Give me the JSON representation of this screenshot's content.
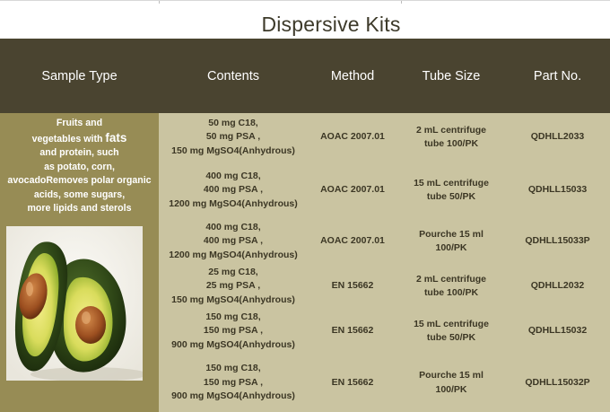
{
  "title": "Dispersive Kits",
  "columns": [
    "Sample Type",
    "Contents",
    "Method",
    "Tube Size",
    "Part No."
  ],
  "sample_type": {
    "line1": "Fruits and",
    "line2_pre": "vegetables with ",
    "line2_big": "fats",
    "line3": "and protein, such",
    "line4": "as potato, corn,",
    "line5": "avocadoRemoves polar organic",
    "line6": "acids, some sugars,",
    "line7": "more lipids and sterols"
  },
  "rows": [
    {
      "contents": [
        "50 mg C18,",
        "50 mg PSA ,",
        "150 mg MgSO4(Anhydrous)"
      ],
      "method": "AOAC 2007.01",
      "tube": [
        "2 mL centrifuge",
        "tube 100/PK"
      ],
      "part": "QDHLL2033"
    },
    {
      "contents": [
        "400 mg C18,",
        "400 mg PSA ,",
        "1200 mg MgSO4(Anhydrous)"
      ],
      "method": "AOAC 2007.01",
      "tube": [
        "15 mL centrifuge",
        "tube 50/PK"
      ],
      "part": "QDHLL15033"
    },
    {
      "contents": [
        "400 mg C18,",
        "400 mg PSA ,",
        "1200 mg MgSO4(Anhydrous)"
      ],
      "method": "AOAC 2007.01",
      "tube": [
        "Pourche 15 ml",
        "100/PK"
      ],
      "part": "QDHLL15033P"
    },
    {
      "contents": [
        "25 mg C18,",
        "25 mg PSA ,",
        "150 mg MgSO4(Anhydrous)"
      ],
      "method": "EN 15662",
      "tube": [
        "2 mL centrifuge",
        "tube 100/PK"
      ],
      "part": "QDHLL2032"
    },
    {
      "contents": [
        "150 mg C18,",
        "150 mg PSA ,",
        "900 mg MgSO4(Anhydrous)"
      ],
      "method": "EN 15662",
      "tube": [
        "15 mL centrifuge",
        "tube 50/PK"
      ],
      "part": "QDHLL15032"
    },
    {
      "contents": [
        "150 mg C18,",
        "150 mg PSA ,",
        "900 mg MgSO4(Anhydrous)"
      ],
      "method": "EN 15662",
      "tube": [
        "Pourche 15 ml",
        "100/PK"
      ],
      "part": "QDHLL15032P"
    }
  ]
}
